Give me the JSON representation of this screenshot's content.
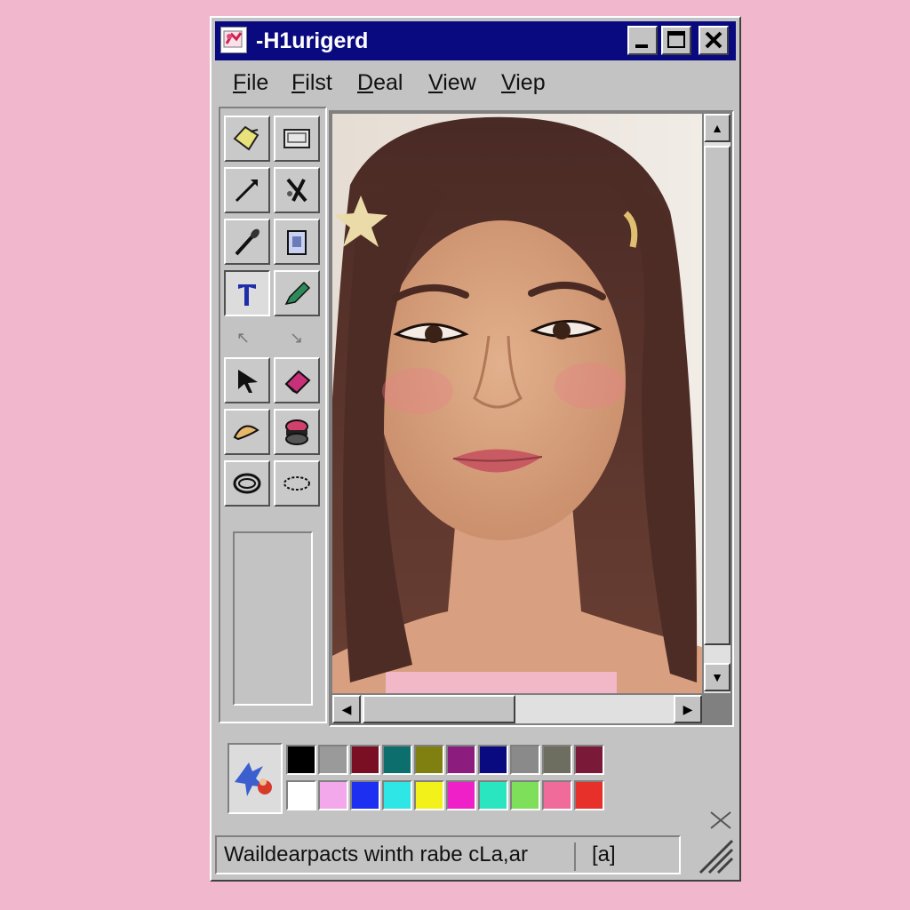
{
  "window": {
    "title": "-H1urigerd"
  },
  "menus": [
    "File",
    "Filst",
    "Deal",
    "View",
    "Viep"
  ],
  "tools": [
    {
      "name": "fill-tool",
      "icon": "paint-bucket-icon"
    },
    {
      "name": "rectangle-select-tool",
      "icon": "screen-select-icon"
    },
    {
      "name": "line-tool",
      "icon": "line-arrow-icon"
    },
    {
      "name": "airbrush-tool",
      "icon": "spray-icon"
    },
    {
      "name": "brush-tool",
      "icon": "brush-icon"
    },
    {
      "name": "copy-tool",
      "icon": "clipboard-icon"
    },
    {
      "name": "text-tool",
      "icon": "text-t-icon"
    },
    {
      "name": "pencil-tool",
      "icon": "pencil-icon"
    },
    {
      "name": "pointer-tool",
      "icon": "arrow-pointer-icon"
    },
    {
      "name": "eraser-tool",
      "icon": "eraser-icon"
    },
    {
      "name": "curve-tool",
      "icon": "curve-icon"
    },
    {
      "name": "stamp-tool",
      "icon": "stamp-icon"
    },
    {
      "name": "ellipse-tool",
      "icon": "ellipse-icon"
    },
    {
      "name": "dotted-ellipse-tool",
      "icon": "dotted-ellipse-icon"
    }
  ],
  "palette": {
    "row1": [
      "#000000",
      "#9a9a9a",
      "#7a0f23",
      "#0d6e6e",
      "#808010",
      "#8c1d7f",
      "#0a0a80",
      "#8a8a8a",
      "#6e6e60",
      "#7a1a38"
    ],
    "row2": [
      "#ffffff",
      "#f2a8ea",
      "#1d2ff0",
      "#2ee6e6",
      "#f2f21a",
      "#f020c8",
      "#2ae6c0",
      "#7ee05a",
      "#f06a9a",
      "#e8302a"
    ]
  },
  "statusbar": {
    "text": "Waildearpacts winth rabe cLa,ar",
    "coords": "[a]"
  }
}
